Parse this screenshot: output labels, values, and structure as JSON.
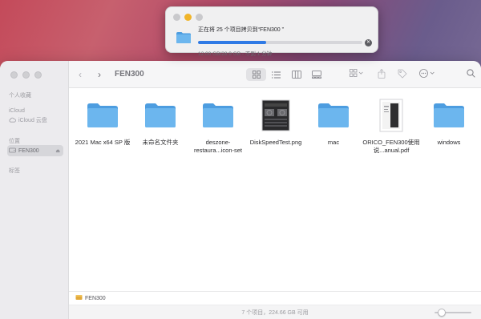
{
  "copy_dialog": {
    "title": "正在将 25 个项目拷贝到“FEN300 ”",
    "subtitle": "12.00 GB/28.9 GB - 不到 1 分钟",
    "progress": 0.415,
    "traffic_colors": [
      "#c9c9cc",
      "#f0b429",
      "#c9c9cc"
    ]
  },
  "sidebar": {
    "favorites_header": "个人收藏",
    "icloud_header": "iCloud",
    "icloud_drive_label": "iCloud 云盘",
    "locations_header": "位置",
    "location_item_label": "FEN300",
    "tags_header": "标签"
  },
  "toolbar": {
    "title": "FEN300"
  },
  "files": [
    {
      "label": "2021 Mac x64 SP 版",
      "kind": "folder"
    },
    {
      "label": "未命名文件夹",
      "kind": "folder"
    },
    {
      "label": "deszone-restaura...icon-set",
      "kind": "folder"
    },
    {
      "label": "DiskSpeedTest.png",
      "kind": "image"
    },
    {
      "label": "mac",
      "kind": "folder"
    },
    {
      "label": "ORICO_FEN300使用说...anual.pdf",
      "kind": "pdf"
    },
    {
      "label": "windows",
      "kind": "folder"
    }
  ],
  "pathbar": {
    "label": "FEN300"
  },
  "status": {
    "text": "7 个项目，224.66 GB 可用",
    "zoom_level": 0.2
  },
  "colors": {
    "folder": "#5eaee6",
    "accent": "#2f7ae5"
  }
}
